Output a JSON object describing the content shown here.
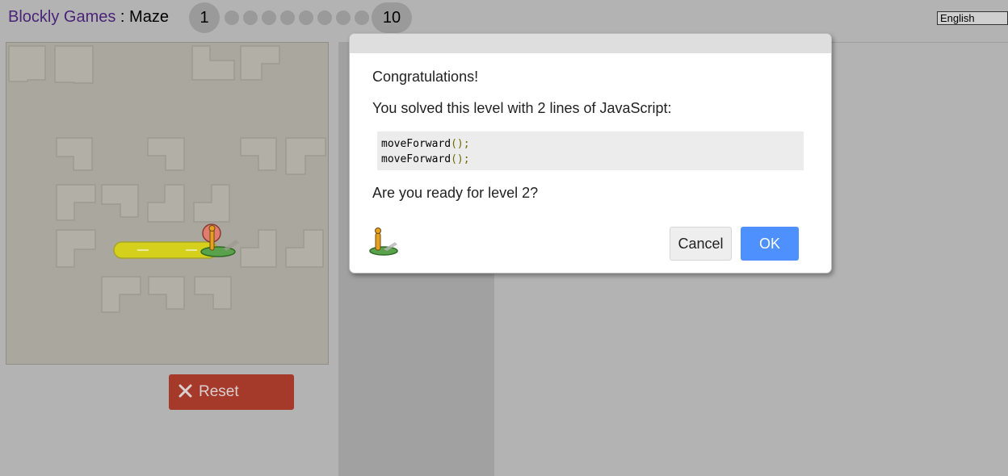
{
  "header": {
    "app_name": "Blockly Games",
    "separator": " : ",
    "game_name": "Maze",
    "levels": {
      "first": "1",
      "last": "10",
      "current": 1,
      "total": 10
    },
    "language": "English"
  },
  "maze": {
    "reset_label": "Reset",
    "reset_icon": "close-x-icon"
  },
  "dialog": {
    "heading": "Congratulations!",
    "message": "You solved this level with 2 lines of JavaScript:",
    "code": [
      {
        "fn": "moveForward",
        "punct": "();"
      },
      {
        "fn": "moveForward",
        "punct": "();"
      }
    ],
    "question": "Are you ready for level 2?",
    "cancel_label": "Cancel",
    "ok_label": "OK",
    "icon": "pegman-icon"
  },
  "colors": {
    "ok_button": "#4d90fe",
    "reset_button": "#a63a2a",
    "app_name": "#4a2479",
    "path": "#d4d01c"
  }
}
